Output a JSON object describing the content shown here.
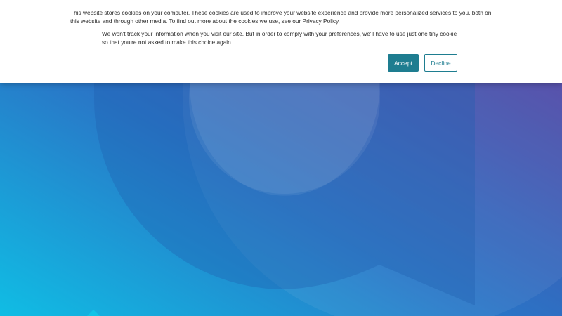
{
  "cookie_banner": {
    "message": "This website stores cookies on your computer. These cookies are used to improve your website experience and provide more personalized services to you, both on this website and through other media. To find out more about the cookies we use, see our Privacy Policy.",
    "secondary_message": "We won't track your information when you visit our site. But in order to comply with your preferences, we'll have to use just one tiny cookie so that you're not asked to make this choice again.",
    "accept_label": "Accept",
    "decline_label": "Decline"
  },
  "colors": {
    "accent": "#1e7d90",
    "hero_gradient_start": "#12b8e0",
    "hero_gradient_mid": "#2a6fc0",
    "hero_gradient_end": "#5a3d9e"
  }
}
